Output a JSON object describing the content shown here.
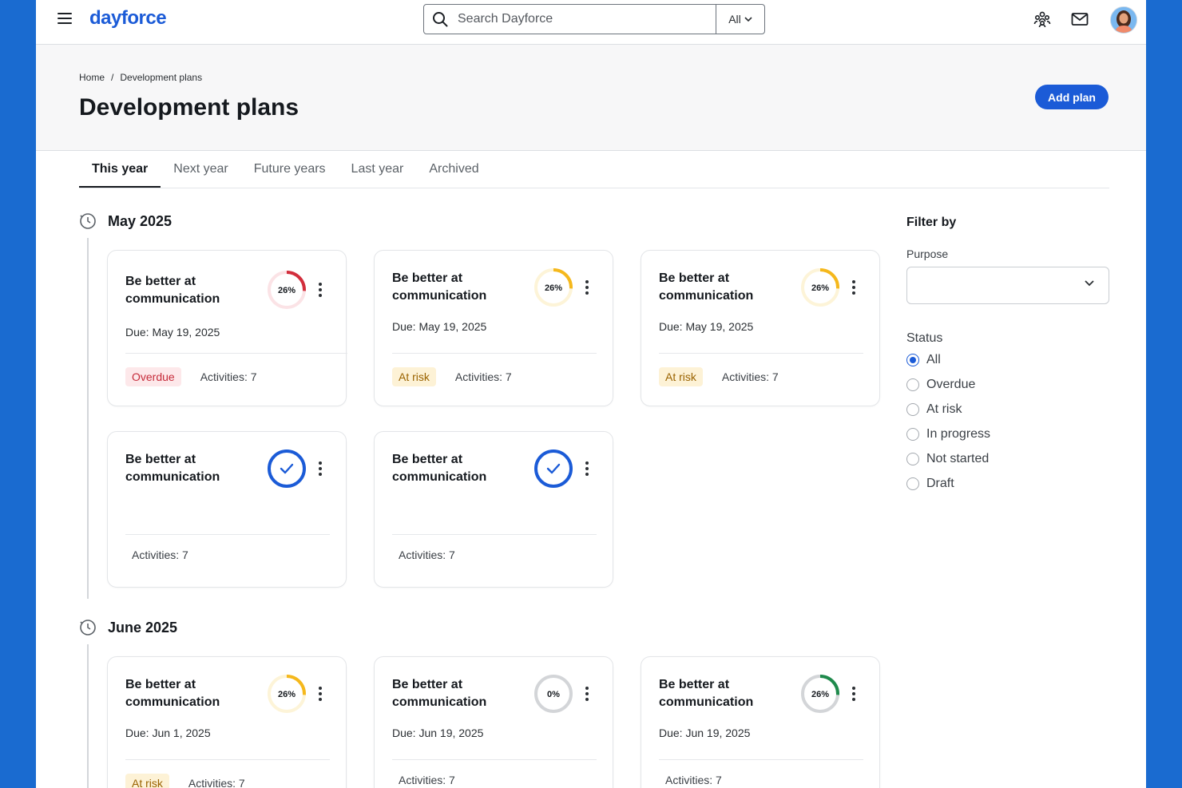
{
  "app": {
    "logo": "dayforce"
  },
  "search": {
    "placeholder": "Search Dayforce",
    "scope": "All"
  },
  "breadcrumb": {
    "home": "Home",
    "separator": "/",
    "current": "Development plans"
  },
  "page": {
    "title": "Development plans",
    "add_label": "Add plan"
  },
  "tabs": [
    "This year",
    "Next year",
    "Future years",
    "Last year",
    "Archived"
  ],
  "months": [
    {
      "label": "May 2025",
      "cards": [
        {
          "title": "Be better at communication",
          "due": "Due: May 19, 2025",
          "badge": "Overdue",
          "badge_type": "overdue",
          "activities": "Activities: 7",
          "progress": 26,
          "progress_label": "26%",
          "ring_color": "#d22e3c",
          "track_color": "#fbe3e6"
        },
        {
          "title": "Be better at communication",
          "due": "Due: May 19, 2025",
          "badge": "At risk",
          "badge_type": "atrisk",
          "activities": "Activities: 7",
          "progress": 26,
          "progress_label": "26%",
          "ring_color": "#f5b81c",
          "track_color": "#fdf4d8"
        },
        {
          "title": "Be better at communication",
          "due": "Due: May 19, 2025",
          "badge": "At risk",
          "badge_type": "atrisk",
          "activities": "Activities: 7",
          "progress": 26,
          "progress_label": "26%",
          "ring_color": "#f5b81c",
          "track_color": "#fdf4d8"
        },
        {
          "title": "Be better at communication",
          "due": "",
          "badge": "",
          "badge_type": "",
          "activities": "Activities: 7",
          "progress": 100,
          "progress_label": "",
          "complete": true,
          "ring_color": "#1b5bd7",
          "track_color": "#1b5bd7"
        },
        {
          "title": "Be better at communication",
          "due": "",
          "badge": "",
          "badge_type": "",
          "activities": "Activities: 7",
          "progress": 100,
          "progress_label": "",
          "complete": true,
          "ring_color": "#1b5bd7",
          "track_color": "#1b5bd7"
        }
      ]
    },
    {
      "label": "June 2025",
      "cards": [
        {
          "title": "Be better at communication",
          "due": "Due: Jun 1, 2025",
          "badge": "At risk",
          "badge_type": "atrisk",
          "activities": "Activities: 7",
          "progress": 26,
          "progress_label": "26%",
          "ring_color": "#f5b81c",
          "track_color": "#fdf4d8"
        },
        {
          "title": "Be better at communication",
          "due": "Due: Jun 19, 2025",
          "badge": "",
          "badge_type": "",
          "activities": "Activities: 7",
          "progress": 0,
          "progress_label": "0%",
          "ring_color": "#c9cccf",
          "track_color": "#d3d5d8"
        },
        {
          "title": "Be better at communication",
          "due": "Due: Jun 19, 2025",
          "badge": "",
          "badge_type": "",
          "activities": "Activities: 7",
          "progress": 26,
          "progress_label": "26%",
          "ring_color": "#1f8a4c",
          "track_color": "#d3d5d8"
        }
      ]
    }
  ],
  "filter": {
    "title": "Filter by",
    "purpose_label": "Purpose",
    "purpose_value": "",
    "status_label": "Status",
    "statuses": [
      "All",
      "Overdue",
      "At risk",
      "In progress",
      "Not started",
      "Draft"
    ],
    "selected_status": "All"
  },
  "colors": {
    "brand": "#1b5bd7",
    "background": "#1a6bd0"
  }
}
